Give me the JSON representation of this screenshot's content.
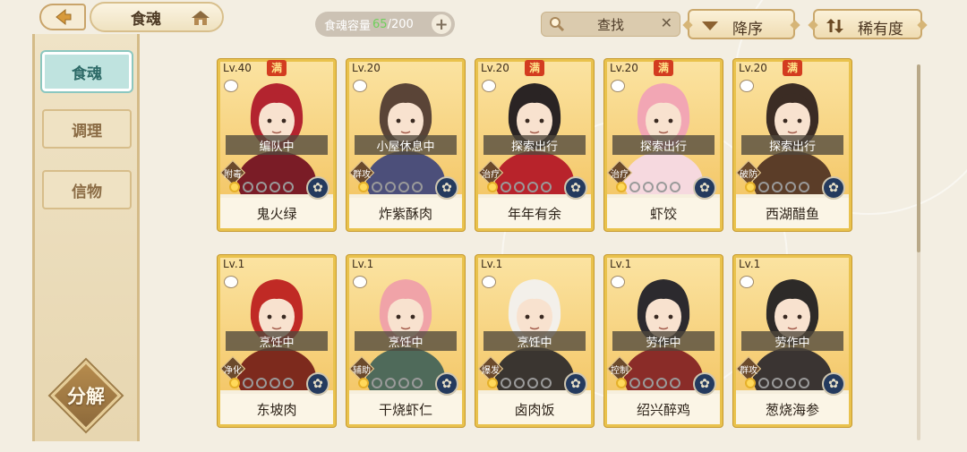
{
  "header": {
    "title": "食魂",
    "capacity_label": "食魂容量",
    "capacity_current": "65",
    "capacity_max": "/200",
    "capacity_add": "+",
    "search_label": "查找",
    "search_clear": "✕",
    "sort_desc_label": "降序",
    "sort_rarity_label": "稀有度"
  },
  "sidebar": {
    "items": [
      {
        "label": "食魂",
        "active": true
      },
      {
        "label": "调理",
        "active": false
      },
      {
        "label": "信物",
        "active": false
      }
    ],
    "decompose_label": "分解"
  },
  "colors": {
    "accent_teal": "#bfe3df",
    "card_border": "#e9c24d",
    "capacity_green": "#6fd05c",
    "full_badge": "#d33c20"
  },
  "cards": [
    {
      "level": "Lv.40",
      "full": "满",
      "status": "编队中",
      "role": "附毒",
      "name": "鬼火绿",
      "stars": 1,
      "hair": "#b3242f",
      "cloth": "#7a1c26"
    },
    {
      "level": "Lv.20",
      "full": "",
      "status": "小屋休息中",
      "role": "群攻",
      "name": "炸紫酥肉",
      "stars": 1,
      "hair": "#5a4437",
      "cloth": "#4c4f7a"
    },
    {
      "level": "Lv.20",
      "full": "满",
      "status": "探索出行",
      "role": "治疗",
      "name": "年年有余",
      "stars": 1,
      "hair": "#2a2424",
      "cloth": "#b8232b"
    },
    {
      "level": "Lv.20",
      "full": "满",
      "status": "探索出行",
      "role": "治疗",
      "name": "虾饺",
      "stars": 1,
      "hair": "#f2a6b4",
      "cloth": "#f6d9df"
    },
    {
      "level": "Lv.20",
      "full": "满",
      "status": "探索出行",
      "role": "破防",
      "name": "西湖醋鱼",
      "stars": 1,
      "hair": "#3b2c24",
      "cloth": "#5b3d28"
    },
    {
      "level": "Lv.1",
      "full": "",
      "status": "烹饪中",
      "role": "净化",
      "name": "东坡肉",
      "stars": 1,
      "hair": "#c02a25",
      "cloth": "#7d2a1d"
    },
    {
      "level": "Lv.1",
      "full": "",
      "status": "烹饪中",
      "role": "辅助",
      "name": "干烧虾仁",
      "stars": 1,
      "hair": "#f0a3a8",
      "cloth": "#4f6a5a"
    },
    {
      "level": "Lv.1",
      "full": "",
      "status": "烹饪中",
      "role": "爆发",
      "name": "卤肉饭",
      "stars": 1,
      "hair": "#f3f0ea",
      "cloth": "#3a3530"
    },
    {
      "level": "Lv.1",
      "full": "",
      "status": "劳作中",
      "role": "控制",
      "name": "绍兴醉鸡",
      "stars": 1,
      "hair": "#2c2a2e",
      "cloth": "#8a2c28"
    },
    {
      "level": "Lv.1",
      "full": "",
      "status": "劳作中",
      "role": "群攻",
      "name": "葱烧海参",
      "stars": 1,
      "hair": "#2d2a28",
      "cloth": "#3a3432"
    }
  ]
}
